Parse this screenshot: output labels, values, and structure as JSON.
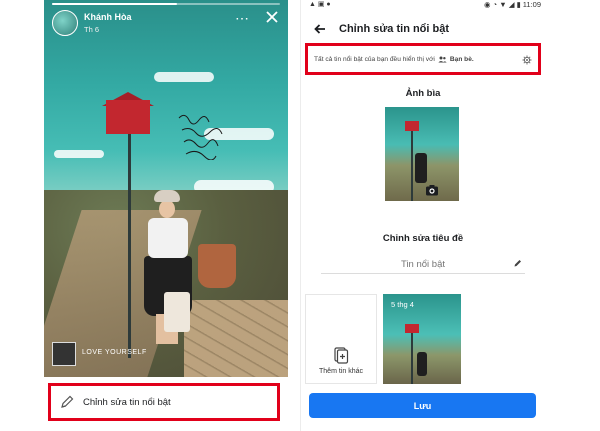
{
  "left_panel": {
    "story": {
      "user_name": "Khánh Hòa",
      "date": "Th 6",
      "more_icon": "⋯",
      "music_text": "LOVE YOURSELF"
    },
    "edit_bar": {
      "label": "Chỉnh sửa tin nổi bật"
    }
  },
  "right_panel": {
    "status_bar": {
      "time": "11:09"
    },
    "header": {
      "title": "Chỉnh sửa tin nổi bật"
    },
    "notice": {
      "text": "Tất cả tin nổi bật của bạn đều hiển thị với",
      "audience": "Bạn bè."
    },
    "cover": {
      "title": "Ảnh bìa"
    },
    "edit_title": {
      "label": "Chỉnh sửa tiêu đề",
      "placeholder": "Tin nổi bật"
    },
    "more_stories": {
      "label": "Thêm tin khác"
    },
    "selected_story": {
      "date": "5 thg 4"
    },
    "save_button": {
      "label": "Lưu"
    }
  },
  "colors": {
    "accent": "#1877f2",
    "highlight": "#e1001a"
  }
}
